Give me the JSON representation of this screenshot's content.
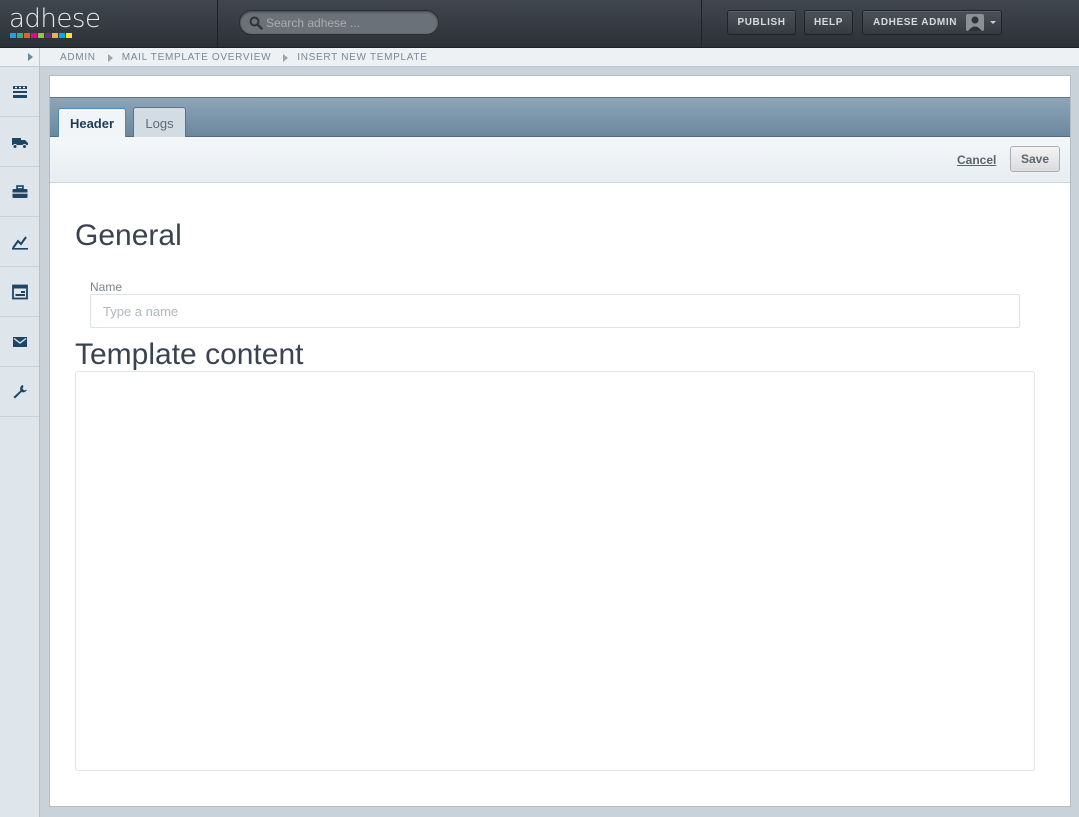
{
  "app": {
    "logo_text": "adhese",
    "logo_colors": [
      "#1aa3d9",
      "#2bb673",
      "#f15a24",
      "#ec008c",
      "#8dc63f",
      "#662d91",
      "#fbb03b",
      "#00aeef",
      "#f7ec13"
    ]
  },
  "search": {
    "placeholder": "Search adhese ..."
  },
  "topnav": {
    "publish_label": "PUBLISH",
    "help_label": "HELP",
    "user_label": "ADHESE ADMIN"
  },
  "breadcrumb": {
    "items": [
      "ADMIN",
      "MAIL TEMPLATE OVERVIEW",
      "INSERT NEW TEMPLATE"
    ]
  },
  "sidebar": {
    "icons": [
      "inventory-icon",
      "delivery-truck-icon",
      "briefcase-icon",
      "reports-icon",
      "publisher-icon",
      "mail-icon",
      "wrench-icon"
    ]
  },
  "tabs": {
    "header_label": "Header",
    "logs_label": "Logs"
  },
  "actions": {
    "cancel_label": "Cancel",
    "save_label": "Save"
  },
  "form": {
    "general_heading": "General",
    "name_label": "Name",
    "name_placeholder": "Type a name",
    "name_value": "",
    "template_heading": "Template content"
  }
}
